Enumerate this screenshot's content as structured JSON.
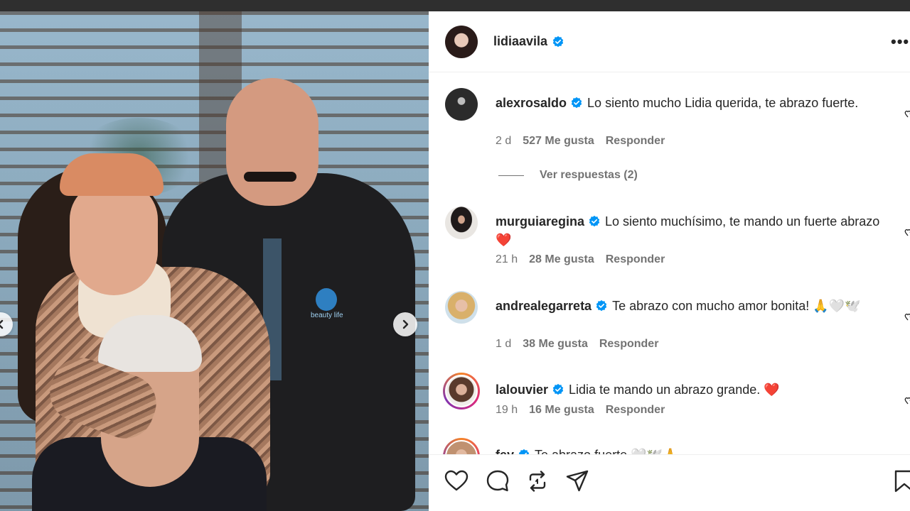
{
  "post": {
    "author": "lidiaavila",
    "more_label": "•••"
  },
  "photo": {
    "logo_text": "beauty life"
  },
  "comments": [
    {
      "username": "alexrosaldo",
      "text": "Lo siento mucho Lidia querida, te abrazo fuerte.",
      "time": "2 d",
      "likes": "527 Me gusta",
      "reply": "Responder",
      "view_replies": "Ver respuestas (2)"
    },
    {
      "username": "murguiaregina",
      "text": "Lo siento muchísimo, te mando un fuerte abrazo ❤️",
      "time": "21 h",
      "likes": "28 Me gusta",
      "reply": "Responder"
    },
    {
      "username": "andrealegarreta",
      "text": "Te abrazo con mucho amor bonita! 🙏🤍🕊️",
      "time": "1 d",
      "likes": "38 Me gusta",
      "reply": "Responder"
    },
    {
      "username": "lalouvier",
      "text": "Lidia te mando un abrazo grande. ❤️",
      "time": "19 h",
      "likes": "16 Me gusta",
      "reply": "Responder"
    },
    {
      "username": "fey",
      "text": "Te abrazo fuerte 🤍🕊️🙏"
    }
  ],
  "icons": {
    "like": "heart-icon",
    "comment": "comment-icon",
    "repost": "repost-icon",
    "share": "send-icon",
    "save": "bookmark-icon",
    "verified": "verified-badge-icon"
  },
  "colors": {
    "verified_blue": "#0095f6",
    "text_primary": "#262626",
    "text_secondary": "#737373"
  }
}
